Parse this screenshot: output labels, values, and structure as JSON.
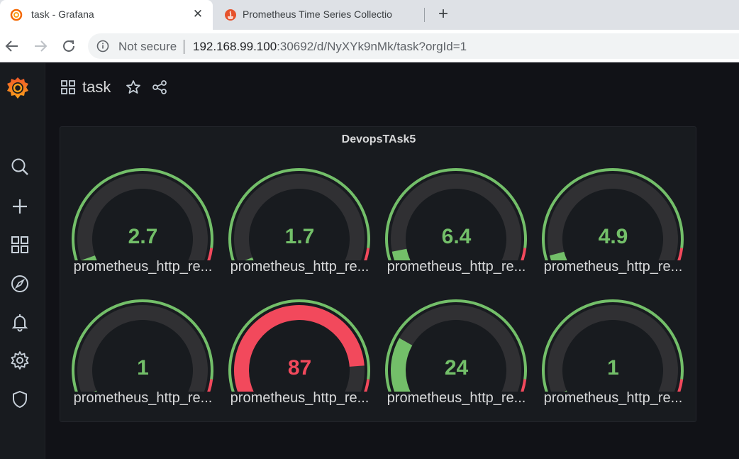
{
  "browser": {
    "tabs": [
      {
        "title": "task - Grafana",
        "active": true,
        "favicon": "grafana-icon"
      },
      {
        "title": "Prometheus Time Series Collectio",
        "active": false,
        "favicon": "prometheus-icon"
      }
    ],
    "address": {
      "security": "Not secure",
      "host": "192.168.99.100",
      "path": ":30692/d/NyXYk9nMk/task?orgId=1"
    }
  },
  "sidebar": {
    "items": [
      "grafana-logo",
      "search-icon",
      "plus-icon",
      "dashboards-icon",
      "explore-icon",
      "alerting-icon",
      "gear-icon",
      "shield-icon"
    ]
  },
  "dashboard": {
    "title": "task"
  },
  "panel": {
    "title": "DevopsTAsk5",
    "colors": {
      "green": "#73bf69",
      "red": "#f2495c",
      "track": "#303033"
    },
    "gauges": [
      {
        "value": "2.7",
        "label": "prometheus_http_re...",
        "fraction": 0.03,
        "color": "green"
      },
      {
        "value": "1.7",
        "label": "prometheus_http_re...",
        "fraction": 0.02,
        "color": "green"
      },
      {
        "value": "6.4",
        "label": "prometheus_http_re...",
        "fraction": 0.064,
        "color": "green"
      },
      {
        "value": "4.9",
        "label": "prometheus_http_re...",
        "fraction": 0.049,
        "color": "green"
      },
      {
        "value": "1",
        "label": "prometheus_http_re...",
        "fraction": 0.01,
        "color": "green"
      },
      {
        "value": "87",
        "label": "prometheus_http_re...",
        "fraction": 0.87,
        "color": "red"
      },
      {
        "value": "24",
        "label": "prometheus_http_re...",
        "fraction": 0.24,
        "color": "green"
      },
      {
        "value": "1",
        "label": "prometheus_http_re...",
        "fraction": 0.01,
        "color": "green"
      }
    ]
  }
}
